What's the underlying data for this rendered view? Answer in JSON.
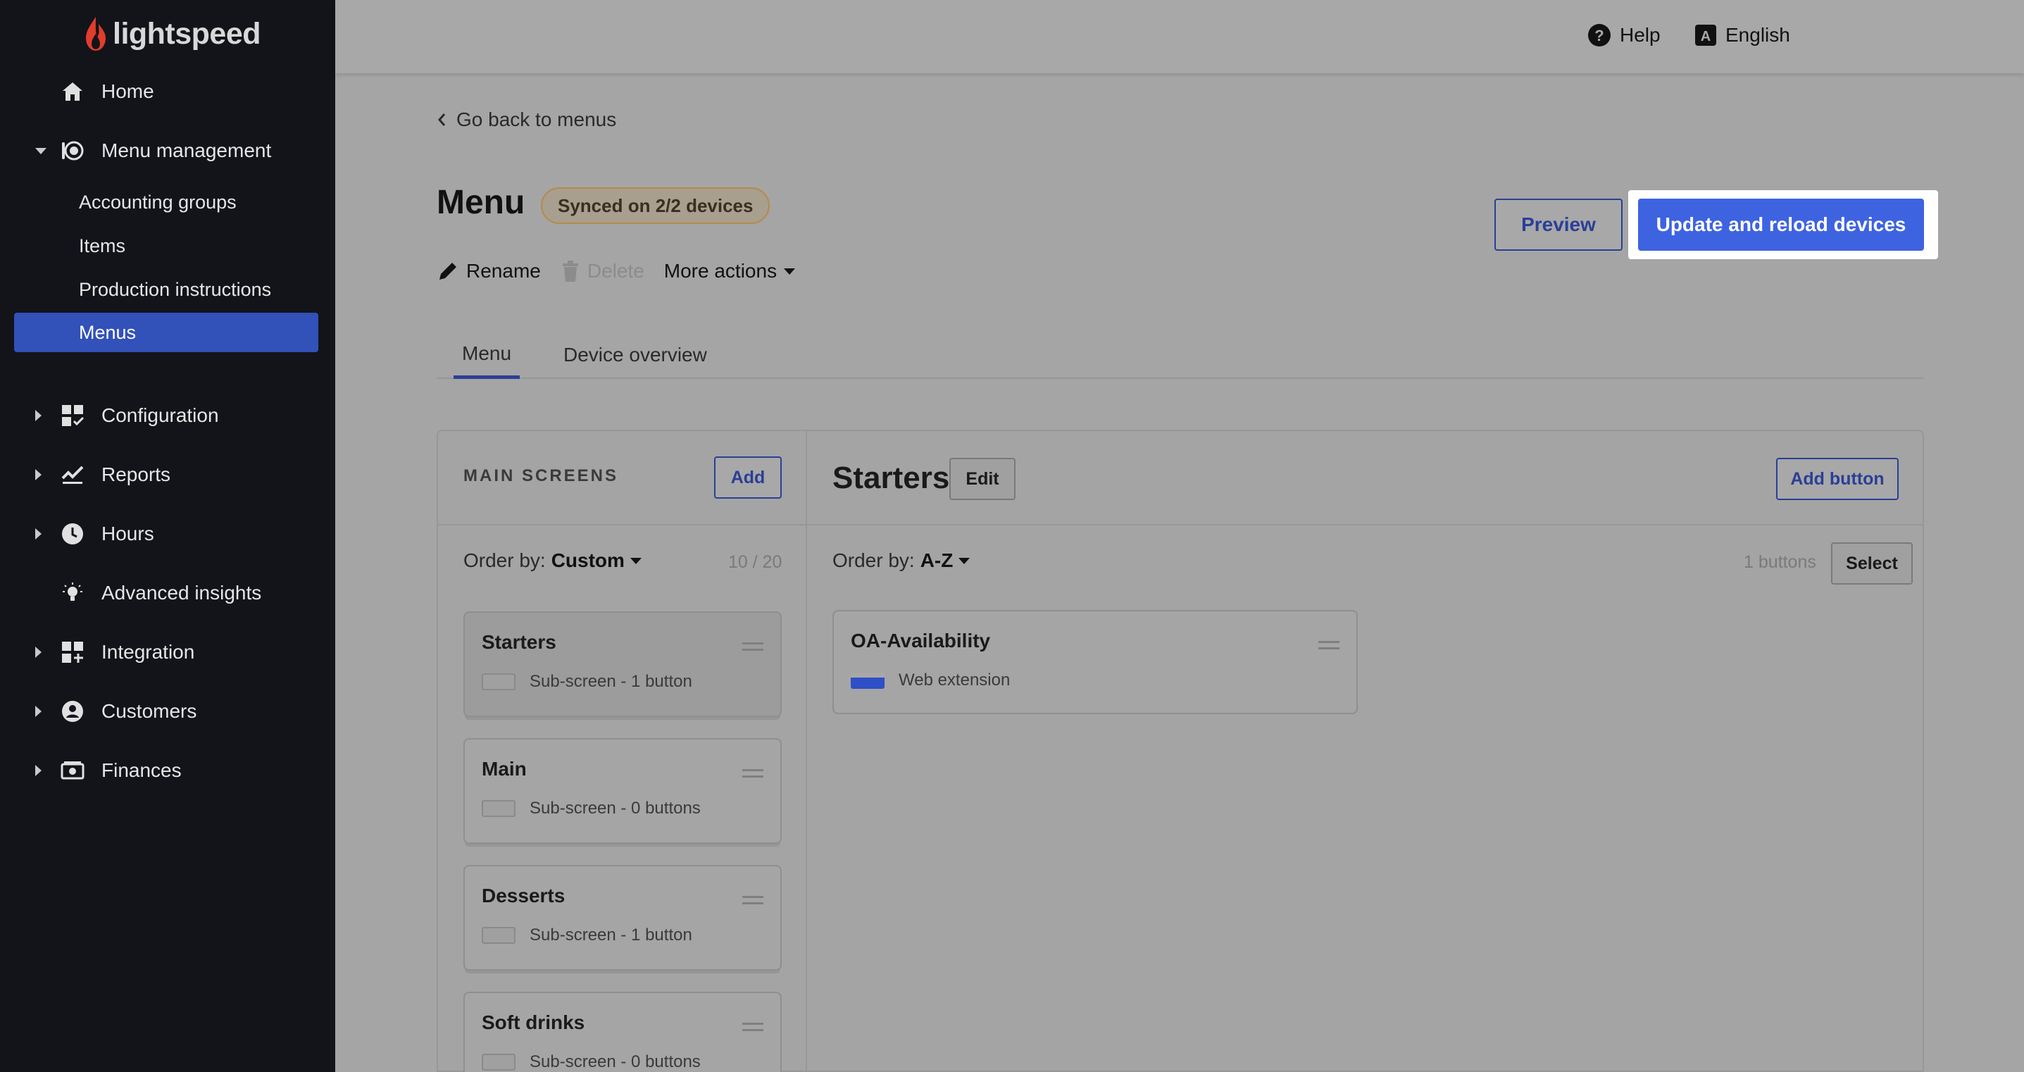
{
  "brand": {
    "name": "lightspeed",
    "accent": "#3e63e0",
    "logo_color": "#e23c2c"
  },
  "sidebar": {
    "home": "Home",
    "menu_management": "Menu management",
    "sub_items": [
      "Accounting groups",
      "Items",
      "Production instructions",
      "Menus"
    ],
    "active_sub": "Menus",
    "configuration": "Configuration",
    "reports": "Reports",
    "hours": "Hours",
    "advanced_insights": "Advanced insights",
    "integration": "Integration",
    "customers": "Customers",
    "finances": "Finances"
  },
  "topbar": {
    "help": "Help",
    "language": "English"
  },
  "page": {
    "back": "Go back to menus",
    "title": "Menu",
    "sync_badge": "Synced on 2/2 devices",
    "rename": "Rename",
    "delete": "Delete",
    "more_actions": "More actions",
    "preview": "Preview",
    "update": "Update and reload devices"
  },
  "tabs": [
    "Menu",
    "Device overview"
  ],
  "main_screens": {
    "heading": "MAIN SCREENS",
    "add": "Add",
    "order_label": "Order by:",
    "order_value": "Custom",
    "count": "10 / 20",
    "cards": [
      {
        "title": "Starters",
        "sub": "Sub-screen - 1 button"
      },
      {
        "title": "Main",
        "sub": "Sub-screen - 0 buttons"
      },
      {
        "title": "Desserts",
        "sub": "Sub-screen - 1 button"
      },
      {
        "title": "Soft drinks",
        "sub": "Sub-screen - 0 buttons"
      }
    ]
  },
  "screen": {
    "title": "Starters",
    "edit": "Edit",
    "add_button": "Add button",
    "order_label": "Order by:",
    "order_value": "A-Z",
    "count": "1 buttons",
    "select": "Select",
    "buttons": [
      {
        "title": "OA-Availability",
        "sub": "Web extension"
      }
    ]
  }
}
